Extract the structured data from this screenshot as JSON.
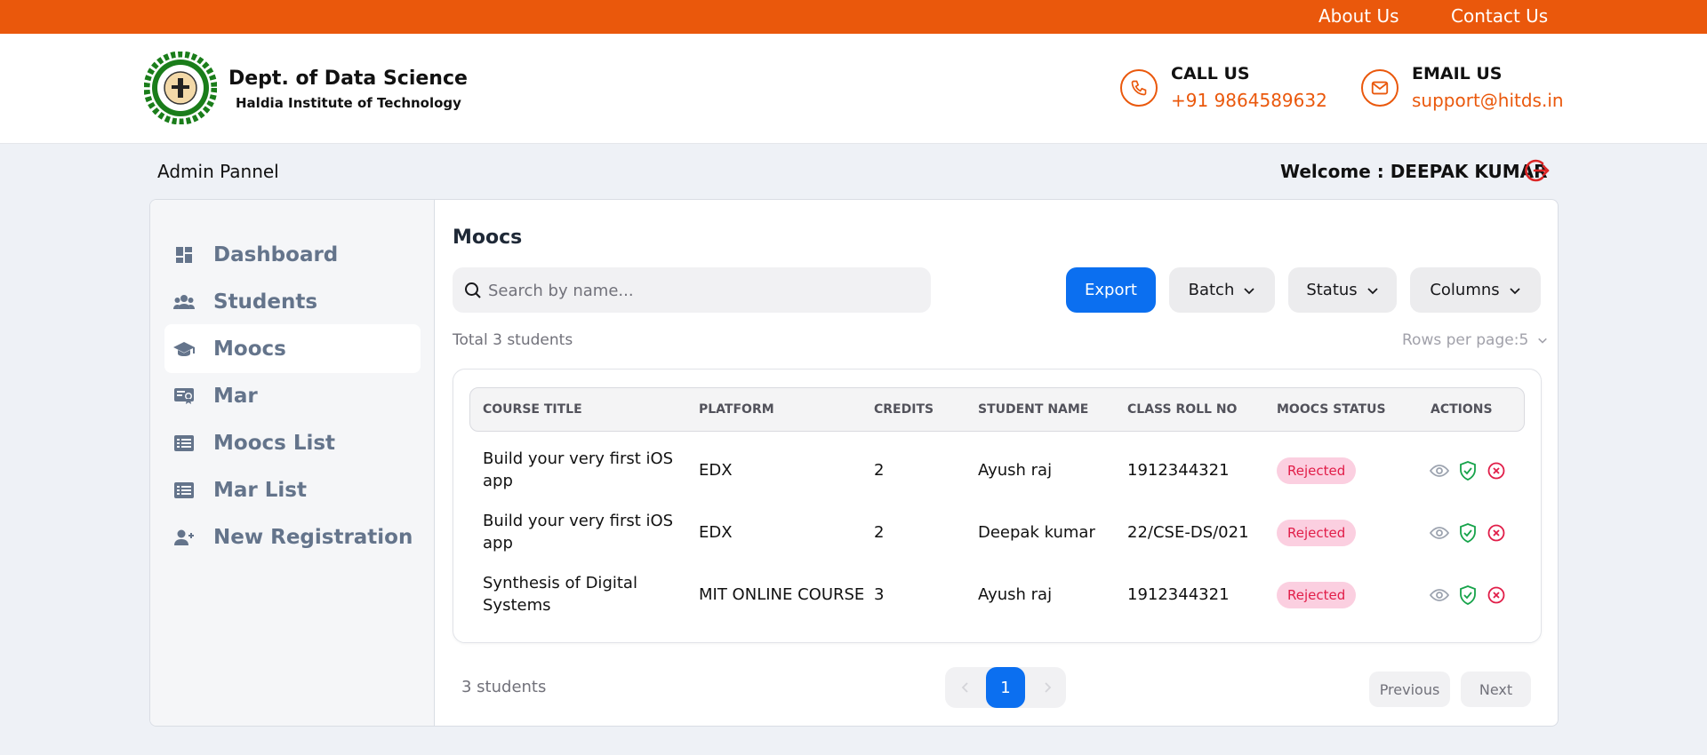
{
  "topbar": {
    "about": "About Us",
    "contact": "Contact Us"
  },
  "header": {
    "title": "Dept. of Data Science",
    "subtitle": "Haldia Institute of Technology",
    "call_label": "CALL US",
    "call_value": "+91 9864589632",
    "email_label": "EMAIL US",
    "email_value": "support@hitds.in"
  },
  "admin_label": "Admin Pannel",
  "welcome": "Welcome : DEEPAK KUMAR",
  "sidebar": {
    "items": [
      {
        "label": "Dashboard",
        "icon": "dashboard-icon"
      },
      {
        "label": "Students",
        "icon": "users-icon"
      },
      {
        "label": "Moocs",
        "icon": "graduation-cap-icon",
        "active": true
      },
      {
        "label": "Mar",
        "icon": "certificate-icon"
      },
      {
        "label": "Moocs List",
        "icon": "list-icon"
      },
      {
        "label": "Mar List",
        "icon": "list-icon"
      },
      {
        "label": "New Registration",
        "icon": "user-plus-icon"
      }
    ]
  },
  "main": {
    "title": "Moocs",
    "search_placeholder": "Search by name...",
    "buttons": {
      "export": "Export",
      "batch": "Batch",
      "status": "Status",
      "columns": "Columns"
    },
    "total": "Total 3 students",
    "rows_per_page": "Rows per page:5",
    "columns": [
      "COURSE TITLE",
      "PLATFORM",
      "CREDITS",
      "STUDENT NAME",
      "CLASS ROLL NO",
      "MOOCS STATUS",
      "ACTIONS"
    ],
    "rows": [
      {
        "course_line1": "Build your very first iOS",
        "course_line2": "app",
        "platform": "EDX",
        "credits": "2",
        "student": "Ayush raj",
        "roll": "1912344321",
        "status": "Rejected"
      },
      {
        "course_line1": "Build your very first iOS",
        "course_line2": "app",
        "platform": "EDX",
        "credits": "2",
        "student": "Deepak kumar",
        "roll": "22/CSE-DS/021",
        "status": "Rejected"
      },
      {
        "course_line1": "Synthesis of Digital",
        "course_line2": "Systems",
        "platform": "MIT ONLINE COURSE",
        "credits": "3",
        "student": "Ayush raj",
        "roll": "1912344321",
        "status": "Rejected"
      }
    ],
    "footer_count": "3 students",
    "current_page": "1",
    "prev": "Previous",
    "next": "Next"
  },
  "colors": {
    "accent": "#ea580c",
    "primary": "#0b6ff0",
    "danger": "#e11d48",
    "success": "#16a34a"
  }
}
